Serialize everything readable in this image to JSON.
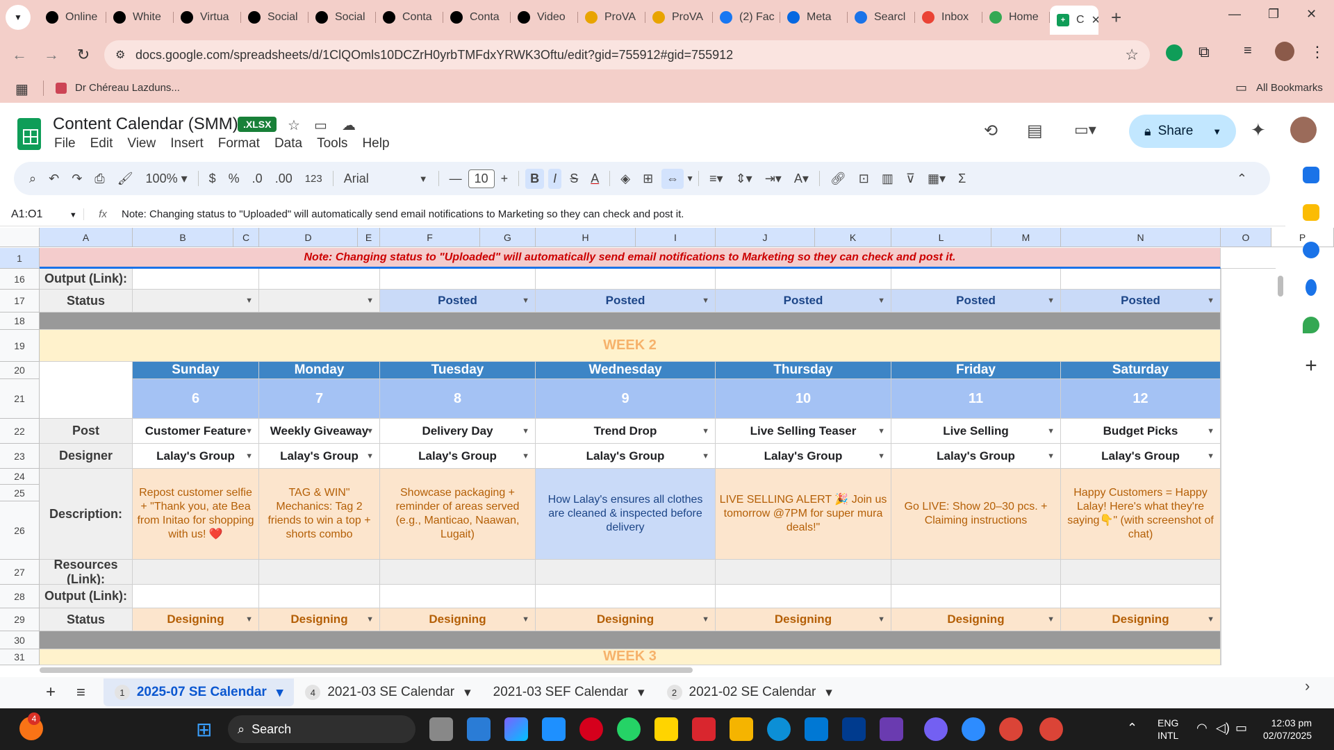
{
  "browser": {
    "tabs": [
      {
        "label": "Online",
        "icon": "threads-icon",
        "color": "#000000"
      },
      {
        "label": "White",
        "icon": "threads-icon",
        "color": "#000000"
      },
      {
        "label": "Virtua",
        "icon": "threads-icon",
        "color": "#000000"
      },
      {
        "label": "Social",
        "icon": "threads-icon",
        "color": "#000000"
      },
      {
        "label": "Social",
        "icon": "threads-icon",
        "color": "#000000"
      },
      {
        "label": "Conta",
        "icon": "threads-icon",
        "color": "#000000"
      },
      {
        "label": "Conta",
        "icon": "threads-icon",
        "color": "#000000"
      },
      {
        "label": "Video",
        "icon": "threads-icon",
        "color": "#000000"
      },
      {
        "label": "ProVA",
        "icon": "w-icon",
        "color": "#e8a400"
      },
      {
        "label": "ProVA",
        "icon": "w-icon",
        "color": "#e8a400"
      },
      {
        "label": "(2) Fac",
        "icon": "facebook-icon",
        "color": "#1877f2"
      },
      {
        "label": "Meta",
        "icon": "meta-icon",
        "color": "#0668e1"
      },
      {
        "label": "Searcl",
        "icon": "search-icon",
        "color": "#1a73e8"
      },
      {
        "label": "Inbox",
        "icon": "gmail-icon",
        "color": "#ea4335"
      },
      {
        "label": "Home",
        "icon": "drive-icon",
        "color": "#34a853"
      }
    ],
    "active_tab": {
      "label": "C",
      "icon": "sheets-icon"
    },
    "url": "docs.google.com/spreadsheets/d/1ClQOmls10DCZrH0yrbTMFdxYRWK3Oftu/edit?gid=755912#gid=755912",
    "bookmark": "Dr Chéreau Lazduns...",
    "all_bookmarks": "All Bookmarks"
  },
  "doc": {
    "title": "Content Calendar (SMM)",
    "badge": ".XLSX",
    "menu": [
      "File",
      "Edit",
      "View",
      "Insert",
      "Format",
      "Data",
      "Tools",
      "Help"
    ],
    "share": "Share"
  },
  "toolbar": {
    "zoom": "100%",
    "currency": "$",
    "percent": "%",
    "dec_dec": ".0",
    "dec_inc": ".00",
    "number_format": "123",
    "font": "Arial",
    "font_size": "10",
    "bold": "B",
    "italic": "I"
  },
  "formula": {
    "namebox": "A1:O1",
    "fx": "fx",
    "content": "Note: Changing status to \"Uploaded\" will automatically send email notifications to Marketing so they can check and post it."
  },
  "columns": [
    "A",
    "B",
    "C",
    "D",
    "E",
    "F",
    "G",
    "H",
    "I",
    "J",
    "K",
    "L",
    "M",
    "N",
    "O",
    "P"
  ],
  "rows": {
    "note": "Note: Changing status to \"Uploaded\" will automatically send email notifications to Marketing so they can check and post it.",
    "labels": {
      "output_link": "Output (Link):",
      "status": "Status",
      "post": "Post",
      "designer": "Designer",
      "description": "Description:",
      "resources": "Resources (Link):"
    },
    "week_title": "WEEK 2",
    "week_next": "WEEK 3",
    "prev_status": [
      "",
      "",
      "Posted",
      "Posted",
      "Posted",
      "Posted",
      "Posted"
    ],
    "days": [
      {
        "name": "Sunday",
        "num": "6",
        "post": "Customer Feature",
        "designer": "Lalay's Group",
        "desc": "Repost customer selfie + \"Thank you, ate Bea from Initao for shopping with us! ❤️",
        "status": "Designing"
      },
      {
        "name": "Monday",
        "num": "7",
        "post": "Weekly Giveaway",
        "designer": "Lalay's Group",
        "desc": "TAG & WIN\" Mechanics: Tag 2 friends to win a top + shorts combo",
        "status": "Designing"
      },
      {
        "name": "Tuesday",
        "num": "8",
        "post": "Delivery Day",
        "designer": "Lalay's Group",
        "desc": "Showcase packaging + reminder of areas served (e.g., Manticao, Naawan, Lugait)",
        "status": "Designing"
      },
      {
        "name": "Wednesday",
        "num": "9",
        "post": "Trend Drop",
        "designer": "Lalay's Group",
        "desc": "How Lalay's ensures all clothes are cleaned & inspected before delivery",
        "status": "Designing"
      },
      {
        "name": "Thursday",
        "num": "10",
        "post": "Live Selling Teaser",
        "designer": "Lalay's Group",
        "desc": "LIVE SELLING ALERT 🎉 Join us tomorrow @7PM for super mura deals!\"",
        "status": "Designing"
      },
      {
        "name": "Friday",
        "num": "11",
        "post": "Live Selling",
        "designer": "Lalay's Group",
        "desc": "Go LIVE: Show 20–30 pcs. + Claiming instructions",
        "status": "Designing"
      },
      {
        "name": "Saturday",
        "num": "12",
        "post": "Budget Picks",
        "designer": "Lalay's Group",
        "desc": "Happy Customers = Happy Lalay! Here's what they're saying👇\" (with screenshot of chat)",
        "status": "Designing"
      }
    ],
    "row_numbers": [
      "1",
      "16",
      "17",
      "18",
      "19",
      "20",
      "21",
      "22",
      "23",
      "24",
      "25",
      "26",
      "27",
      "28",
      "29",
      "30",
      "31"
    ]
  },
  "sheet_tabs": [
    {
      "badge": "1",
      "label": "2025-07 SE Calendar",
      "active": true
    },
    {
      "badge": "4",
      "label": "2021-03 SE Calendar",
      "active": false
    },
    {
      "badge": "",
      "label": "2021-03 SEF Calendar",
      "active": false
    },
    {
      "badge": "2",
      "label": "2021-02 SE Calendar",
      "active": false
    }
  ],
  "taskbar": {
    "search": "Search",
    "notification_count": "4",
    "lang1": "ENG",
    "lang2": "INTL",
    "time": "12:03 pm",
    "date": "02/07/2025"
  },
  "colors": {
    "browser_chrome": "#f3cfc9",
    "note_bg": "#f4cccc",
    "note_text": "#cc0000",
    "week_bg": "#fff2cc",
    "week_text": "#f6b26b",
    "day_header": "#3d85c6",
    "day_num": "#a4c2f4",
    "posted_bg": "#c9daf8",
    "designing_bg": "#fce5cd",
    "desc_peach": "#fce5cd",
    "desc_blue": "#c9daf8"
  }
}
